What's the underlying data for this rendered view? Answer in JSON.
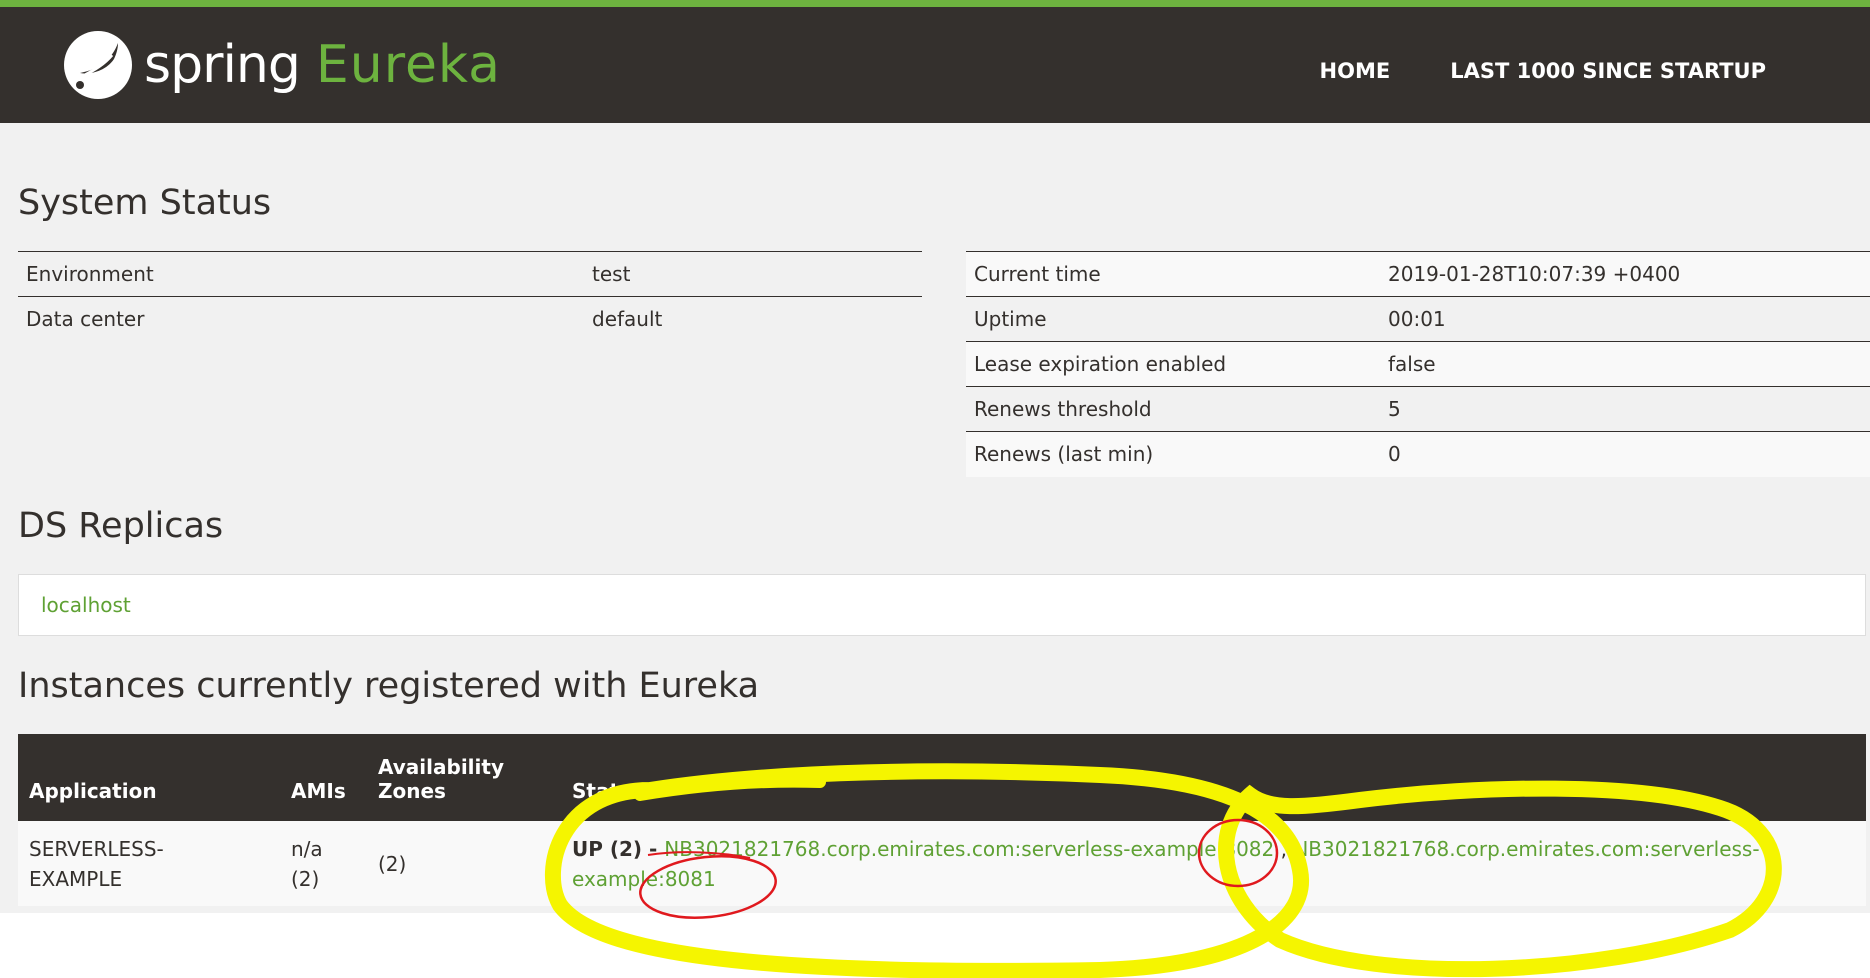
{
  "brand": {
    "spring": "spring",
    "eureka": "Eureka"
  },
  "nav": {
    "home": "HOME",
    "last1000": "LAST 1000 SINCE STARTUP"
  },
  "system_status": {
    "title": "System Status",
    "left": [
      {
        "label": "Environment",
        "value": "test"
      },
      {
        "label": "Data center",
        "value": "default"
      }
    ],
    "right": [
      {
        "label": "Current time",
        "value": "2019-01-28T10:07:39 +0400"
      },
      {
        "label": "Uptime",
        "value": "00:01"
      },
      {
        "label": "Lease expiration enabled",
        "value": "false"
      },
      {
        "label": "Renews threshold",
        "value": "5"
      },
      {
        "label": "Renews (last min)",
        "value": "0"
      }
    ]
  },
  "ds_replicas": {
    "title": "DS Replicas",
    "link": "localhost"
  },
  "instances": {
    "title": "Instances currently registered with Eureka",
    "headers": {
      "application": "Application",
      "amis": "AMIs",
      "zones_line1": "Availability",
      "zones_line2": "Zones",
      "status": "Status"
    },
    "rows": [
      {
        "application_line1": "SERVERLESS-",
        "application_line2": "EXAMPLE",
        "amis_line1": "n/a",
        "amis_line2": "(2)",
        "zones": "(2)",
        "status_prefix": "UP (2) - ",
        "instance1": "NB3021821768.corp.emirates.com:serverless-example:8082",
        "separator": " , ",
        "instance2_line1": "NB3021821768.corp.emirates.com:serverless-",
        "instance2_line2": "example:8081"
      }
    ]
  },
  "colors": {
    "header_bg": "#34302d",
    "brand_green": "#6db33f",
    "link_green": "#5fa134",
    "annotation_yellow": "#f5f500",
    "annotation_red": "#e0191e"
  }
}
